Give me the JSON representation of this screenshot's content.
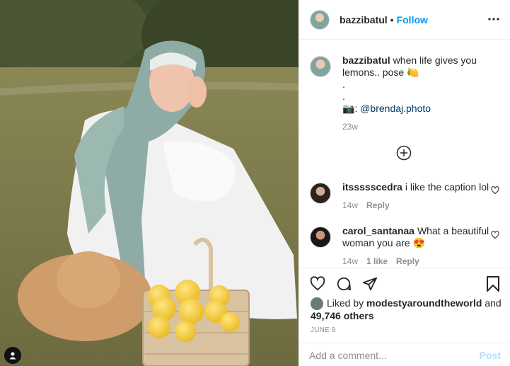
{
  "header": {
    "username": "bazzibatul",
    "separator": "•",
    "follow_label": "Follow",
    "more_icon": "more-horizontal-icon"
  },
  "caption": {
    "username": "bazzibatul",
    "text_line1": "when life gives you lemons.. pose",
    "emoji": "🍋",
    "dot1": ".",
    "dot2": ".",
    "camera_emoji": "📷",
    "mention_prefix": ":",
    "mention": "@brendaj.photo",
    "age": "23w"
  },
  "load_more_icon": "plus-circle-icon",
  "comments": [
    {
      "username": "itssssscedra",
      "text": "i like the caption lol",
      "age": "14w",
      "reply_label": "Reply"
    },
    {
      "username": "carol_santanaa",
      "text": "What a beautiful woman you are",
      "emoji": "😍",
      "age": "14w",
      "likes": "1 like",
      "reply_label": "Reply"
    }
  ],
  "actions": {
    "like_icon": "heart-icon",
    "comment_icon": "comment-icon",
    "share_icon": "paper-plane-icon",
    "save_icon": "bookmark-icon"
  },
  "likes": {
    "prefix": "Liked by",
    "liker": "modestyaroundtheworld",
    "conj": "and",
    "others": "49,746 others"
  },
  "date": "JUNE 9",
  "add_comment": {
    "placeholder": "Add a comment...",
    "post_label": "Post"
  },
  "colors": {
    "accent": "#0095f6",
    "post_disabled": "#b2dffc",
    "muted": "#8e8e8e",
    "text": "#262626"
  }
}
